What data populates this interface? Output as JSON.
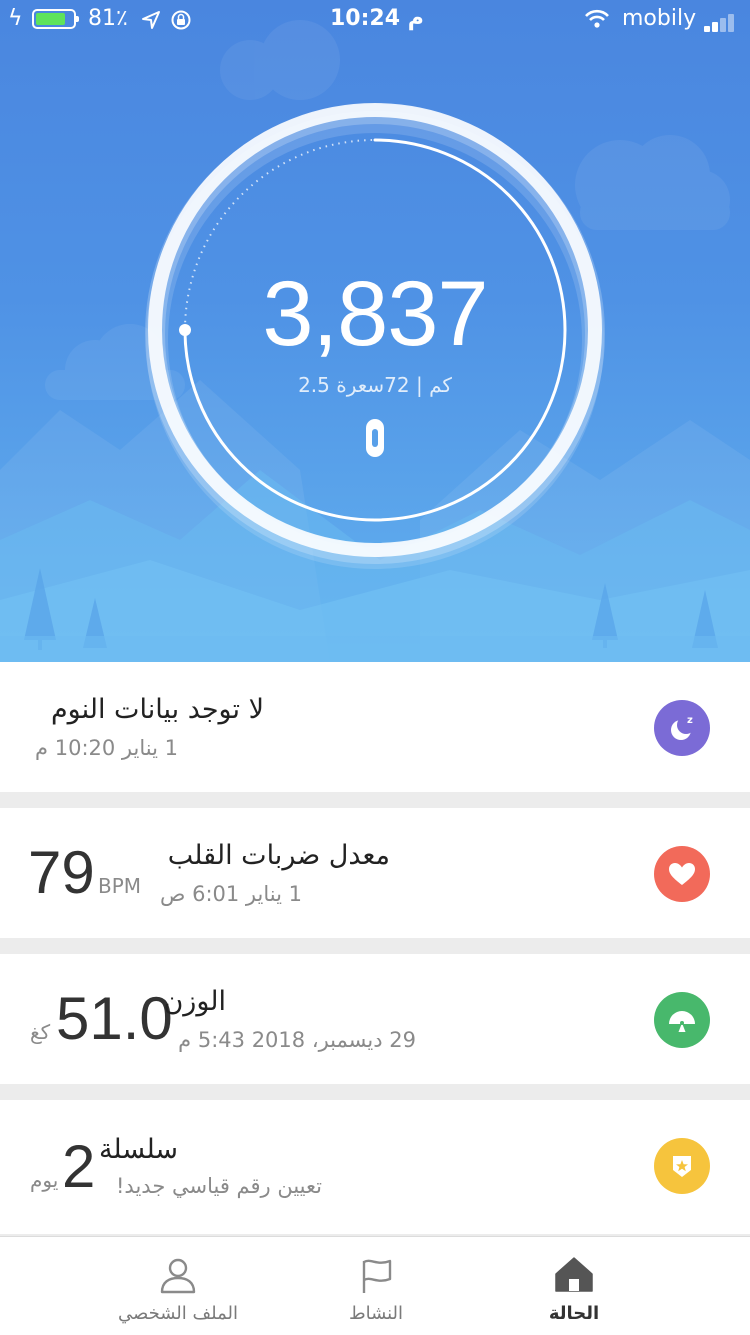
{
  "status_bar": {
    "battery_percent": "81٪",
    "battery_level": 0.81,
    "time": "10:24 م",
    "carrier": "mobily"
  },
  "activity": {
    "steps": "3,837",
    "summary": "2.5 كم | 72سعرة",
    "goal_progress": 0.75
  },
  "cards": {
    "sleep": {
      "title": "لا توجد بيانات النوم",
      "date": "1 يناير 10:20 م",
      "icon_color": "#7b6bd6"
    },
    "heart": {
      "title": "معدل ضربات القلب",
      "date": "1 يناير 6:01 ص",
      "value": "79",
      "unit": "BPM",
      "icon_color": "#f26a5a"
    },
    "weight": {
      "title": "الوزن",
      "date": "29 ديسمبر، 2018 5:43 م",
      "value": "51.0",
      "unit": "كغ",
      "icon_color": "#48b86c"
    },
    "streak": {
      "title": "سلسلة",
      "subtitle": "تعيين رقم قياسي جديد!",
      "value": "2",
      "unit": "يوم",
      "icon_color": "#f6c43d"
    }
  },
  "tabs": {
    "profile": "الملف الشخصي",
    "activity": "النشاط",
    "status": "الحالة",
    "active": "status"
  }
}
